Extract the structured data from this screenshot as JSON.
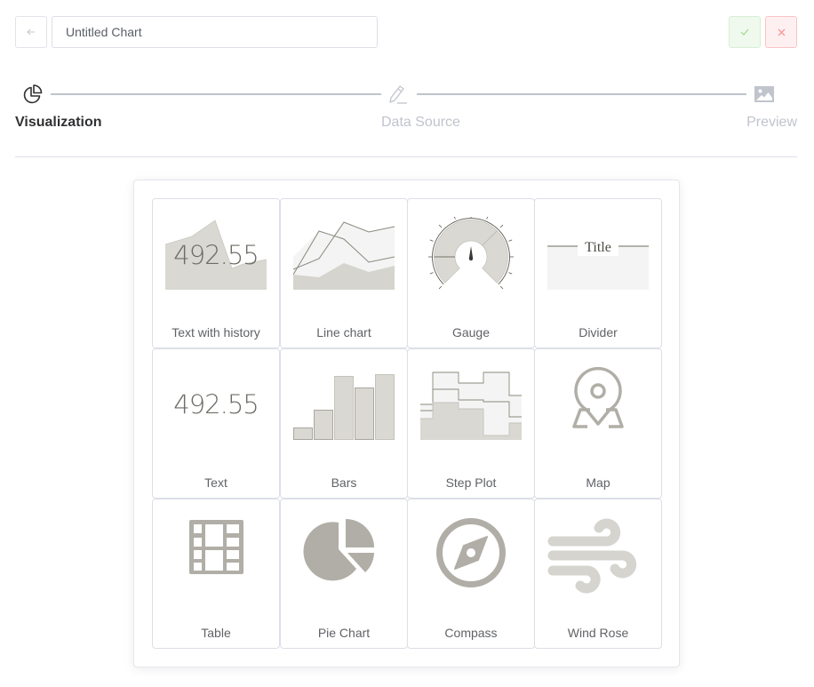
{
  "toolbar": {
    "back_icon": "arrow-left-icon",
    "title_value": "Untitled Chart",
    "confirm_icon": "check-icon",
    "cancel_icon": "close-icon",
    "colors": {
      "confirm": "#67c23a",
      "cancel": "#f56c6c"
    }
  },
  "steps": [
    {
      "label": "Visualization",
      "icon": "pie-chart-outline-icon",
      "state": "active"
    },
    {
      "label": "Data Source",
      "icon": "pencil-icon",
      "state": "inactive"
    },
    {
      "label": "Preview",
      "icon": "image-icon",
      "state": "inactive"
    }
  ],
  "visualizations": [
    {
      "label": "Text with history",
      "icon": "text-with-history-thumbnail",
      "sample_value": "492.55"
    },
    {
      "label": "Line chart",
      "icon": "line-chart-thumbnail"
    },
    {
      "label": "Gauge",
      "icon": "gauge-thumbnail"
    },
    {
      "label": "Divider",
      "icon": "divider-thumbnail",
      "sample_title": "Title"
    },
    {
      "label": "Text",
      "icon": "text-thumbnail",
      "sample_value": "492.55"
    },
    {
      "label": "Bars",
      "icon": "bars-thumbnail"
    },
    {
      "label": "Step Plot",
      "icon": "step-plot-thumbnail"
    },
    {
      "label": "Map",
      "icon": "map-marker-icon"
    },
    {
      "label": "Table",
      "icon": "table-icon"
    },
    {
      "label": "Pie Chart",
      "icon": "pie-chart-icon"
    },
    {
      "label": "Compass",
      "icon": "compass-icon"
    },
    {
      "label": "Wind Rose",
      "icon": "wind-icon"
    }
  ],
  "thumbnail_colors": {
    "fill": "#d9d8d2",
    "light_fill": "#f4f4f4",
    "stroke": "#8a887e",
    "icon": "#b0aea6",
    "wind": "#d5d4ce",
    "needle": "#3a3833"
  }
}
